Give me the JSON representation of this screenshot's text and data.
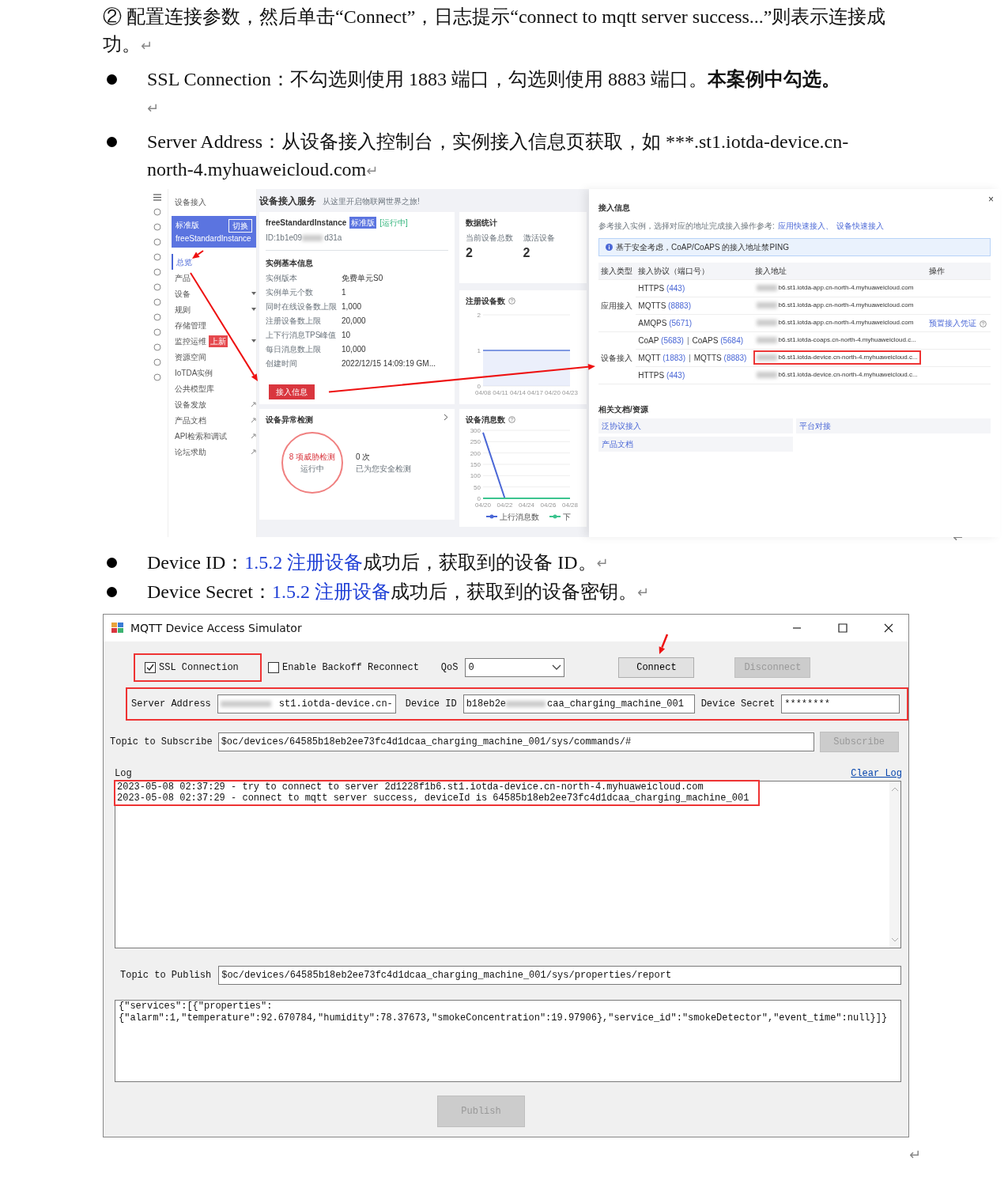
{
  "intro": {
    "text": "② 配置连接参数，然后单击“Connect”，日志提示“connect to mqtt server success...”则表示连接成功。",
    "end_mark": "↵"
  },
  "bullets": [
    {
      "text": "SSL Connection：不勾选则使用 1883 端口，勾选则使用 8883 端口。**本案例中勾选。**",
      "end_mark": "↵"
    },
    {
      "text": "Server Address：从设备接入控制台，实例接入信息页获取，如 ***.st1.iotda-device.cn-north-4.myhuaweicloud.com",
      "end_mark": "↵"
    }
  ],
  "console": {
    "sidebar": {
      "title": "设备接入",
      "instance": {
        "edition": "标准版",
        "switch": "切换",
        "name": "freeStandardInstance"
      },
      "items": [
        {
          "label": "总览",
          "kind": "plain",
          "selected": true
        },
        {
          "label": "产品",
          "kind": "plain",
          "selected": false
        },
        {
          "label": "设备",
          "kind": "dropdown",
          "selected": false
        },
        {
          "label": "规则",
          "kind": "dropdown",
          "selected": false
        },
        {
          "label": "存储管理",
          "kind": "plain",
          "selected": false
        },
        {
          "label": "监控运维",
          "kind": "dropdown",
          "selected": false,
          "badge": "上新"
        },
        {
          "label": "资源空间",
          "kind": "plain",
          "selected": false
        },
        {
          "label": "IoTDA实例",
          "kind": "plain",
          "selected": false
        },
        {
          "label": "公共模型库",
          "kind": "plain",
          "selected": false
        },
        {
          "label": "设备发放",
          "kind": "link",
          "selected": false
        },
        {
          "label": "产品文档",
          "kind": "link",
          "selected": false
        },
        {
          "label": "API检索和调试",
          "kind": "link",
          "selected": false
        },
        {
          "label": "论坛求助",
          "kind": "link",
          "selected": false
        }
      ]
    },
    "header": {
      "title": "设备接入服务",
      "subtitle": "从这里开启物联网世界之旅!"
    },
    "instance_card": {
      "name": "freeStandardInstance",
      "tag": "标准版",
      "status": "[运行中]",
      "id_start": "ID:1b1e09",
      "id_end": "d31a",
      "section": "实例基本信息",
      "rows": [
        {
          "label": "实例版本",
          "value": "免费单元S0"
        },
        {
          "label": "实例单元个数",
          "value": "1"
        },
        {
          "label": "同时在线设备数上限",
          "value": "1,000"
        },
        {
          "label": "注册设备数上限",
          "value": "20,000"
        },
        {
          "label": "上下行消息TPS峰值",
          "value": "10"
        },
        {
          "label": "每日消息数上限",
          "value": "10,000"
        },
        {
          "label": "创建时间",
          "value": "2022/12/15 14:09:19 GM..."
        }
      ],
      "button": "接入信息"
    },
    "stats_card": {
      "title": "数据统计",
      "items": [
        {
          "label": "当前设备总数",
          "value": "2"
        },
        {
          "label": "激活设备",
          "value": "2"
        }
      ]
    },
    "registered_card": {
      "title": "注册设备数",
      "chart_data": {
        "type": "area",
        "categories": [
          "04/08",
          "04/11",
          "04/14",
          "04/17",
          "04/20",
          "04/23"
        ],
        "values": [
          1,
          1,
          1,
          1,
          1,
          1
        ],
        "ylim": [
          0,
          2
        ],
        "yticks": [
          0,
          1,
          2
        ],
        "grid": true
      }
    },
    "anomaly_card": {
      "title": "设备异常检测",
      "ring_main": "8 项威胁检测",
      "ring_sub": "运行中",
      "count": "0 次",
      "note": "已为您安全检测"
    },
    "messages_card": {
      "title": "设备消息数",
      "chart_data": {
        "type": "line",
        "categories": [
          "04/20",
          "04/22",
          "04/24",
          "04/26",
          "04/28"
        ],
        "series": [
          {
            "name": "上行消息数",
            "color": "#4a67d6",
            "values": [
              290,
              0,
              null,
              null,
              null
            ]
          },
          {
            "name": "下",
            "color": "#3cc48f",
            "values": [
              0,
              0,
              0,
              0,
              0
            ]
          }
        ],
        "ylim": [
          0,
          300
        ],
        "yticks": [
          0,
          50,
          100,
          150,
          200,
          250,
          300
        ],
        "grid": true,
        "legend": "bottom"
      }
    },
    "dialog": {
      "title": "接入信息",
      "close": "×",
      "hint": "参考接入实例，选择对应的地址完成接入操作参考:",
      "hint_links": [
        "应用快速接入、",
        "设备快速接入"
      ],
      "notice": "基于安全考虑，CoAP/CoAPS 的接入地址禁PING",
      "columns": [
        "接入类型",
        "接入协议（端口号）",
        "接入地址",
        "操作"
      ],
      "groups": [
        {
          "type": "应用接入",
          "rows": [
            {
              "protocols": [
                {
                  "name": "HTTPS",
                  "port": "(443)"
                }
              ],
              "address": "b6.st1.iotda-app.cn-north-4.myhuaweicloud.com",
              "highlight": false
            },
            {
              "protocols": [
                {
                  "name": "MQTTS",
                  "port": "(8883)"
                }
              ],
              "address": "b6.st1.iotda-app.cn-north-4.myhuaweicloud.com",
              "highlight": false
            },
            {
              "protocols": [
                {
                  "name": "AMQPS",
                  "port": "(5671)"
                }
              ],
              "address": "b6.st1.iotda-app.cn-north-4.myhuaweicloud.com",
              "action": "预置接入凭证",
              "highlight": false
            }
          ]
        },
        {
          "type": "设备接入",
          "rows": [
            {
              "protocols": [
                {
                  "name": "CoAP",
                  "port": "(5683)"
                },
                {
                  "name": "CoAPS",
                  "port": "(5684)"
                }
              ],
              "separator": "|",
              "address": "b6.st1.iotda-coaps.cn-north-4.myhuaweicloud.c...",
              "highlight": false
            },
            {
              "protocols": [
                {
                  "name": "MQTT",
                  "port": "(1883)"
                },
                {
                  "name": "MQTTS",
                  "port": "(8883)"
                }
              ],
              "separator": "|",
              "address": "b6.st1.iotda-device.cn-north-4.myhuaweicloud.c...",
              "highlight": true
            },
            {
              "protocols": [
                {
                  "name": "HTTPS",
                  "port": "(443)"
                }
              ],
              "address": "b6.st1.iotda-device.cn-north-4.myhuaweicloud.c...",
              "highlight": false
            }
          ]
        }
      ],
      "docs_title": "相关文档/资源",
      "docs": [
        "泛协议接入",
        "平台对接",
        "产品文档"
      ]
    }
  },
  "figure_end_mark": "↵",
  "bullets2": [
    {
      "label": "Device ID：",
      "link": "1.5.2 注册设备",
      "rest": "成功后，获取到的设备 ID。",
      "end_mark": "↵"
    },
    {
      "label": "Device Secret：",
      "link": "1.5.2 注册设备",
      "rest": "成功后，获取到的设备密钥。",
      "end_mark": "↵"
    }
  ],
  "simulator": {
    "title": "MQTT Device Access Simulator",
    "ssl": {
      "label": "SSL Connection",
      "checked": true,
      "highlight": true
    },
    "backoff": {
      "label": "Enable Backoff Reconnect",
      "checked": false
    },
    "qos": {
      "label": "QoS",
      "value": "0"
    },
    "buttons": [
      {
        "label": "Connect",
        "disabled": false
      },
      {
        "label": "Disconnect",
        "disabled": true
      }
    ],
    "connection_highlight": true,
    "server_address": {
      "label": "Server Address",
      "value": "st1.iotda-device.cn-"
    },
    "device_id": {
      "label": "Device ID",
      "value_start": "b18eb2e",
      "value_end": "caa_charging_machine_001"
    },
    "device_secret": {
      "label": "Device Secret",
      "value": "********"
    },
    "subscribe": {
      "label": "Topic to Subscribe",
      "value": "$oc/devices/64585b18eb2ee73fc4d1dcaa_charging_machine_001/sys/commands/#",
      "button": "Subscribe",
      "disabled": true
    },
    "log": {
      "label": "Log",
      "clear": "Clear Log",
      "highlight": true,
      "lines": [
        "2023-05-08 02:37:29 - try to connect to server 2d1228f1b6.st1.iotda-device.cn-north-4.myhuaweicloud.com",
        "2023-05-08 02:37:29 - connect to mqtt server success, deviceId is 64585b18eb2ee73fc4d1dcaa_charging_machine_001"
      ]
    },
    "publish": {
      "label": "Topic to Publish",
      "value": "$oc/devices/64585b18eb2ee73fc4d1dcaa_charging_machine_001/sys/properties/report",
      "payload_lines": [
        "{\"services\":[{\"properties\":",
        "{\"alarm\":1,\"temperature\":92.670784,\"humidity\":78.37673,\"smokeConcentration\":19.97906},\"service_id\":\"smokeDetector\",\"event_time\":null}]}"
      ],
      "button": "Publish",
      "disabled": true
    }
  },
  "end_mark": "↵"
}
